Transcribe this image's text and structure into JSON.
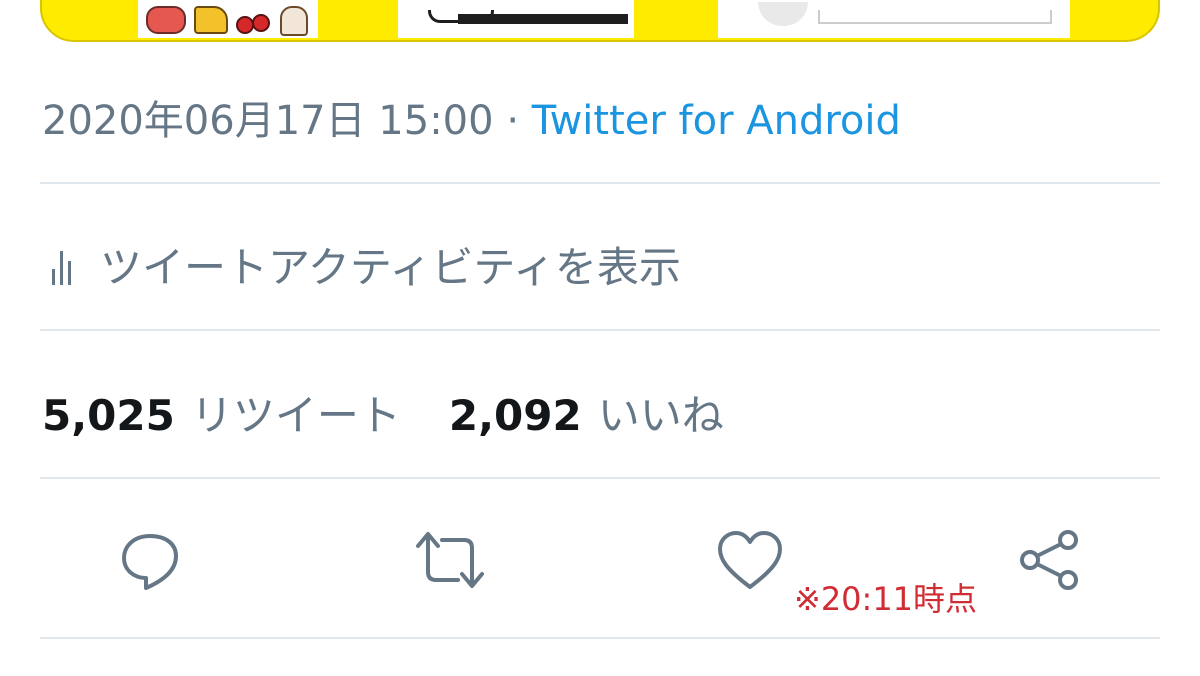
{
  "tweet": {
    "timestamp": "2020年06月17日 15:00",
    "separator": "·",
    "source": "Twitter for Android",
    "activity_link": "ツイートアクティビティを表示",
    "retweet_count": "5,025",
    "retweet_label": "リツイート",
    "like_count": "2,092",
    "like_label": "いいね"
  },
  "actions": [
    {
      "icon": "reply-icon"
    },
    {
      "icon": "retweet-icon"
    },
    {
      "icon": "heart-icon"
    },
    {
      "icon": "share-icon"
    }
  ],
  "annotation": {
    "text": "※20:11時点",
    "color": "#d12c34"
  },
  "colors": {
    "banner": "#ffeb00",
    "link": "#1b95e0",
    "secondary_text": "#657786",
    "primary_text": "#14171a",
    "divider": "#e1e8ed"
  }
}
